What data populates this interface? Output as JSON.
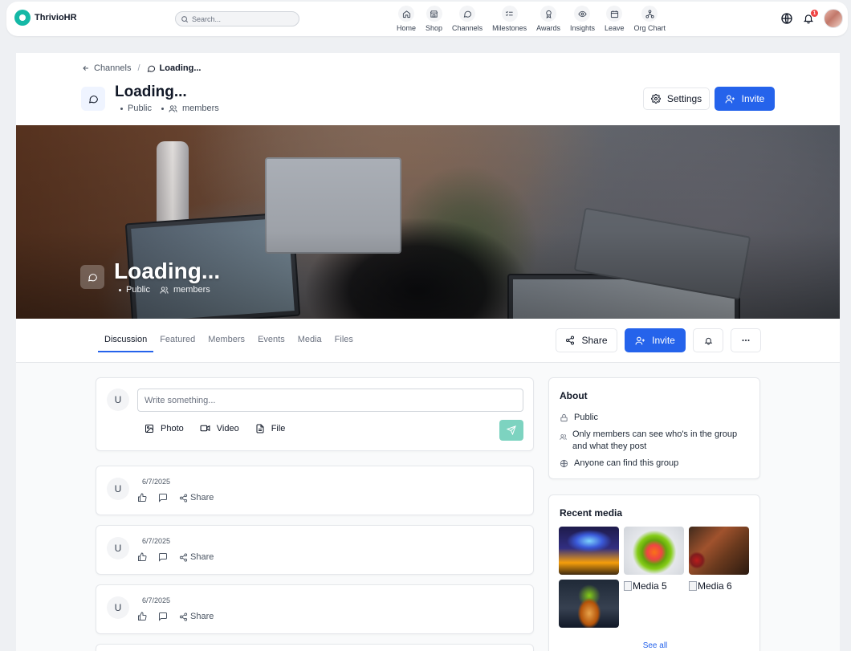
{
  "app": {
    "name": "ThrivioHR"
  },
  "search": {
    "placeholder": "Search..."
  },
  "nav": [
    {
      "label": "Home",
      "icon": "home-icon"
    },
    {
      "label": "Shop",
      "icon": "shop-icon"
    },
    {
      "label": "Channels",
      "icon": "chat-icon"
    },
    {
      "label": "Milestones",
      "icon": "list-check-icon"
    },
    {
      "label": "Awards",
      "icon": "award-icon"
    },
    {
      "label": "Insights",
      "icon": "eye-icon"
    },
    {
      "label": "Leave",
      "icon": "calendar-icon"
    },
    {
      "label": "Org Chart",
      "icon": "org-chart-icon"
    }
  ],
  "notifications": {
    "count": "1"
  },
  "breadcrumb": {
    "parent": "Channels",
    "separator": "/",
    "current": "Loading..."
  },
  "header": {
    "title": "Loading...",
    "visibility": "Public",
    "members": "members",
    "settings_label": "Settings",
    "invite_label": "Invite"
  },
  "cover": {
    "title": "Loading...",
    "visibility": "Public",
    "members": "members"
  },
  "tabs": [
    "Discussion",
    "Featured",
    "Members",
    "Events",
    "Media",
    "Files"
  ],
  "active_tab": "Discussion",
  "tab_actions": {
    "share_label": "Share",
    "invite_label": "Invite"
  },
  "composer": {
    "avatar": "U",
    "placeholder": "Write something...",
    "photo_label": "Photo",
    "video_label": "Video",
    "file_label": "File"
  },
  "posts": [
    {
      "avatar": "U",
      "date": "6/7/2025",
      "share_label": "Share"
    },
    {
      "avatar": "U",
      "date": "6/7/2025",
      "share_label": "Share"
    },
    {
      "avatar": "U",
      "date": "6/7/2025",
      "share_label": "Share"
    }
  ],
  "about": {
    "title": "About",
    "rows": [
      "Public",
      "Only members can see who's in the group and what they post",
      "Anyone can find this group"
    ]
  },
  "recent_media": {
    "title": "Recent media",
    "broken": [
      "Media 5",
      "Media 6"
    ],
    "see_all": "See all"
  },
  "colors": {
    "primary": "#2563eb",
    "brand": "#14b8a6",
    "send": "#7dd3c0",
    "badge": "#ef4444"
  }
}
